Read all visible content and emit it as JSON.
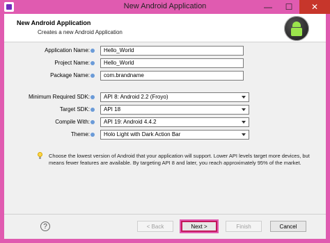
{
  "window": {
    "title": "New Android Application",
    "minimize_label": "—",
    "maximize_label": "☐",
    "close_label": "✕"
  },
  "header": {
    "title": "New Android Application",
    "subtitle": "Creates a new Android Application",
    "logo_icon": "android-logo-icon"
  },
  "form": {
    "application_name_label": "Application Name:",
    "application_name_value": "Hello_World",
    "project_name_label": "Project Name:",
    "project_name_value": "Hello_World",
    "package_name_label": "Package Name:",
    "package_name_value": "com.brandname",
    "min_sdk_label": "Minimum Required SDK:",
    "min_sdk_value": "API 8: Android 2.2 (Froyo)",
    "target_sdk_label": "Target SDK:",
    "target_sdk_value": "API 18",
    "compile_with_label": "Compile With:",
    "compile_with_value": "API 19: Android 4.4.2",
    "theme_label": "Theme:",
    "theme_value": "Holo Light with Dark Action Bar"
  },
  "hint": {
    "text": "Choose the lowest version of Android that your application will support. Lower API levels target more devices, but means fewer features are available. By targeting API 8 and later, you reach approximately 95% of the market."
  },
  "footer": {
    "help_icon": "help-icon",
    "back_label": "< Back",
    "next_label": "Next >",
    "finish_label": "Finish",
    "cancel_label": "Cancel"
  }
}
